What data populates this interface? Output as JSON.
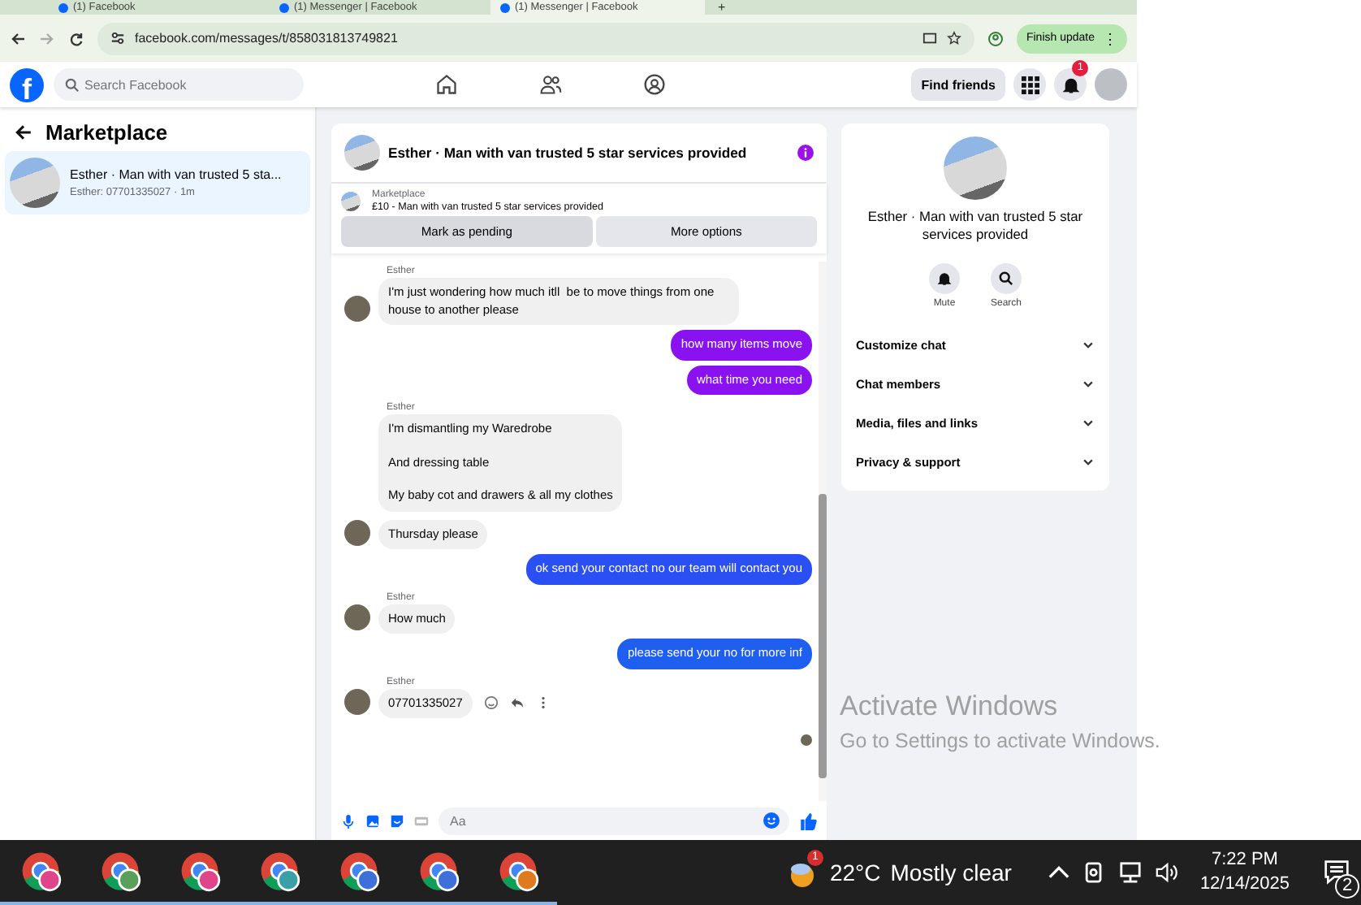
{
  "browser": {
    "tabs": [
      {
        "title": "(1) Facebook",
        "selected": false
      },
      {
        "title": "(1) Messenger | Facebook",
        "selected": false
      },
      {
        "title": "(1) Messenger | Facebook",
        "selected": true
      }
    ],
    "new_tab": "+",
    "url": "facebook.com/messages/t/858031813749821",
    "update_button": "Finish update",
    "update_menu": "⋮"
  },
  "header": {
    "logo": "f",
    "search_placeholder": "Search Facebook",
    "find_friends": "Find friends",
    "notification_count": "1"
  },
  "sidebar": {
    "title": "Marketplace",
    "conversations": [
      {
        "title": "Esther · Man with van trusted 5 sta...",
        "preview": "Esther: 07701335027 · 1m",
        "selected": true
      }
    ]
  },
  "chat": {
    "title": "Esther · Man with van trusted 5 star services provided",
    "listing_label": "Marketplace",
    "listing": "£10 - Man with van trusted 5 star services provided",
    "buttons": [
      "Mark as pending",
      "More options"
    ],
    "messages": [
      {
        "kind": "incoming",
        "sender": "Esther",
        "paragraphs": [
          "I'm just wondering how much itll  be to move things from one house to another please"
        ],
        "avatar": true,
        "actions": false
      },
      {
        "kind": "outgoing",
        "color": "#8a12f0",
        "paragraphs": [
          "how many items move"
        ]
      },
      {
        "kind": "outgoing",
        "color": "#8a12f0",
        "paragraphs": [
          "what time you need"
        ]
      },
      {
        "kind": "incoming",
        "sender": "Esther",
        "paragraphs": [
          "I'm dismantling my Waredrobe",
          "And dressing table",
          "My baby cot and drawers & all my clothes"
        ],
        "avatar": false,
        "actions": false
      },
      {
        "kind": "incoming",
        "paragraphs": [
          "Thursday please"
        ],
        "avatar": true,
        "actions": false
      },
      {
        "kind": "outgoing",
        "color": "#2a4ff2",
        "paragraphs": [
          "ok send your contact no our team will contact you"
        ]
      },
      {
        "kind": "incoming",
        "sender": "Esther",
        "paragraphs": [
          "How much"
        ],
        "avatar": true,
        "actions": false
      },
      {
        "kind": "outgoing",
        "color": "#1f5ff0",
        "paragraphs": [
          "please send your no for more inf"
        ]
      },
      {
        "kind": "incoming",
        "sender": "Esther",
        "paragraphs": [
          "07701335027"
        ],
        "avatar": true,
        "actions": true
      }
    ],
    "seen": true,
    "composer_placeholder": "Aa"
  },
  "details": {
    "name": "Esther · Man with van trusted 5 star services provided",
    "actions": [
      "Mute",
      "Search"
    ],
    "sections": [
      {
        "label": "Customize chat",
        "expanded": false
      },
      {
        "label": "Chat members",
        "expanded": false
      },
      {
        "label": "Media, files and links",
        "expanded": false
      },
      {
        "label": "Privacy & support",
        "expanded": false
      }
    ]
  },
  "desktop": {
    "watermark_title": "Activate Windows",
    "watermark_text": "Go to Settings to activate Windows."
  },
  "taskbar": {
    "apps": [
      {
        "color": "#e0448a"
      },
      {
        "color": "#5aa05a"
      },
      {
        "color": "#e0448a"
      },
      {
        "color": "#3aa0a8"
      },
      {
        "color": "#3f6fd8"
      },
      {
        "color": "#3f6fd8"
      },
      {
        "color": "#e07a20"
      }
    ],
    "weather_badge": "1",
    "temperature": "22°C",
    "weather": "Mostly clear",
    "time": "7:22 PM",
    "date": "12/14/2025",
    "notification_count": "2"
  }
}
